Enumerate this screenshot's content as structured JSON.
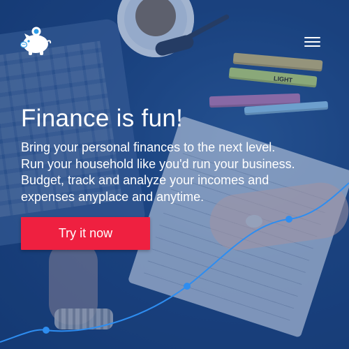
{
  "brand": {
    "logo_icon": "piggy-bank-icon"
  },
  "header": {
    "menu_icon": "hamburger-menu-icon"
  },
  "hero": {
    "headline": "Finance is fun!",
    "description_lines": [
      "Bring your personal finances to the next level.",
      "Run your household like you'd run your business.",
      "Budget, track and analyze your incomes and",
      "expenses anyplace and anytime."
    ],
    "cta_label": "Try it now"
  },
  "background": {
    "marker_label": "LIGHT"
  },
  "colors": {
    "overlay": "#1c4582",
    "accent": "#ef2040",
    "chart_line": "#2e8df0",
    "text": "#ffffff"
  }
}
